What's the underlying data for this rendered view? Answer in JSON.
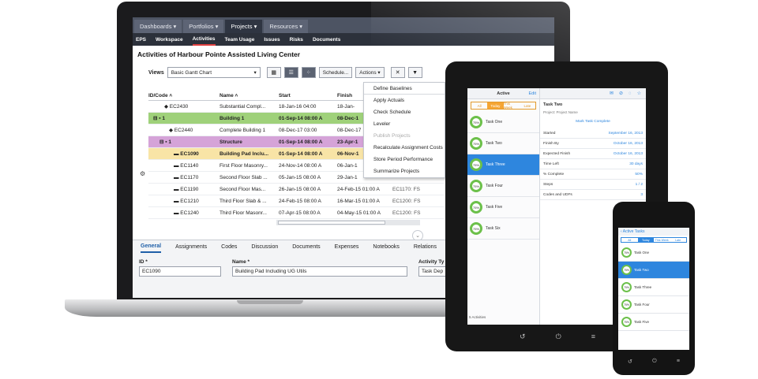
{
  "laptop": {
    "top_tabs": [
      "Dashboards ▾",
      "Portfolios ▾",
      "Projects ▾",
      "Resources ▾"
    ],
    "sub_tabs": [
      "EPS",
      "Workspace",
      "Activities",
      "Team Usage",
      "Issues",
      "Risks",
      "Documents"
    ],
    "page_title": "Activities of Harbour Pointe Assisted Living Center",
    "toolbar": {
      "views_label": "Views",
      "views_value": "Basic Gantt Chart",
      "schedule_label": "Schedule...",
      "actions_label": "Actions ▾"
    },
    "grid": {
      "headers": [
        "ID/Code ˄",
        "Name ˄",
        "Start",
        "Finish"
      ],
      "rows": [
        {
          "id": "◆ EC2430",
          "name": "Substantial Compl...",
          "start": "18-Jan-16 04:00",
          "finish": "18-Jan-",
          "extra": ""
        },
        {
          "id": "⊟ ▪ 1",
          "name": "Building 1",
          "start": "01-Sep-14 08:00 A",
          "finish": "08-Dec-1",
          "extra": ""
        },
        {
          "id": "◆ EC2440",
          "name": "Complete Building 1",
          "start": "08-Dec-17 03:00",
          "finish": "08-Dec-17",
          "extra": ""
        },
        {
          "id": "⊟ ▪ 1",
          "name": "Structure",
          "start": "01-Sep-14 08:00 A",
          "finish": "23-Apr-1",
          "extra": ""
        },
        {
          "id": "▬ EC1090",
          "name": "Building Pad Inclu...",
          "start": "01-Sep-14 08:00 A",
          "finish": "06-Nov-1",
          "extra": ""
        },
        {
          "id": "▬ EC1140",
          "name": "First Floor Masonry...",
          "start": "24-Nov-14 08:00 A",
          "finish": "06-Jan-1",
          "extra": ""
        },
        {
          "id": "▬ EC1170",
          "name": "Second Floor Slab ...",
          "start": "05-Jan-15 08:00 A",
          "finish": "29-Jan-1",
          "extra": ""
        },
        {
          "id": "▬ EC1190",
          "name": "Second Floor Mas...",
          "start": "26-Jan-15 08:00 A",
          "finish": "24-Feb-15 01:00 A",
          "extra": "EC1170: FS"
        },
        {
          "id": "▬ EC1210",
          "name": "Third Floor Slab & ...",
          "start": "24-Feb-15 08:00 A",
          "finish": "16-Mar-15 01:00 A",
          "extra": "EC1200: FS"
        },
        {
          "id": "▬ EC1240",
          "name": "Third Floor Masonr...",
          "start": "07-Apr-15 08:00 A",
          "finish": "04-May-15 01:00 A",
          "extra": "EC1200: FS"
        }
      ]
    },
    "actions_menu": [
      "Define Baselines",
      "Apply Actuals",
      "Check Schedule",
      "Leveler",
      "Publish Projects",
      "Recalculate Assignment Costs",
      "Store Period Performance",
      "Summarize Projects"
    ],
    "detail_tabs": [
      "General",
      "Assignments",
      "Codes",
      "Discussion",
      "Documents",
      "Expenses",
      "Notebooks",
      "Relations"
    ],
    "fields": {
      "id_label": "ID *",
      "id_value": "EC1090",
      "name_label": "Name *",
      "name_value": "Building Pad Including UG Utils",
      "type_label": "Activity Ty",
      "type_value": "Task Dep"
    }
  },
  "tablet": {
    "list_title": "Active",
    "edit_label": "Edit",
    "segments": [
      "All",
      "Today",
      "This Week",
      "Late"
    ],
    "items": [
      {
        "pct": "75%",
        "title": "Task One"
      },
      {
        "pct": "75%",
        "title": "Task Two"
      },
      {
        "pct": "75%",
        "title": "Task Three"
      },
      {
        "pct": "75%",
        "title": "Task Four"
      },
      {
        "pct": "75%",
        "title": "Task Five"
      },
      {
        "pct": "75%",
        "title": "Task Six"
      }
    ],
    "detail_title": "Task Two",
    "detail_sub": "Project:  Project Name",
    "mark_complete": "Mark Task Complete",
    "detail_rows": [
      {
        "k": "Started",
        "v": "September 16, 2013"
      },
      {
        "k": "Finish By",
        "v": "October 16, 2013"
      },
      {
        "k": "Expected Finish",
        "v": "October 16, 2013"
      },
      {
        "k": "Time Left",
        "v": "30 days"
      },
      {
        "k": "% Complete",
        "v": "50%"
      },
      {
        "k": "Steps",
        "v": "1 / 2"
      },
      {
        "k": "Codes and UDFs",
        "v": "3"
      }
    ],
    "footer": "5 Activities",
    "keys": [
      "↺",
      "⏻",
      "≡"
    ]
  },
  "phone": {
    "header": "‹ Active Tasks",
    "segments": [
      "All",
      "Today",
      "This Week",
      "Late"
    ],
    "items": [
      {
        "pct": "75%",
        "title": "Task One"
      },
      {
        "pct": "75%",
        "title": "Task Two"
      },
      {
        "pct": "75%",
        "title": "Task Three"
      },
      {
        "pct": "75%",
        "title": "Task Four"
      },
      {
        "pct": "75%",
        "title": "Task Five"
      }
    ],
    "keys": [
      "↺",
      "⏻",
      "≡"
    ]
  },
  "colors": {
    "accent": "#2e86de",
    "progress": "#6cc04a",
    "nav": "#4d5463"
  }
}
